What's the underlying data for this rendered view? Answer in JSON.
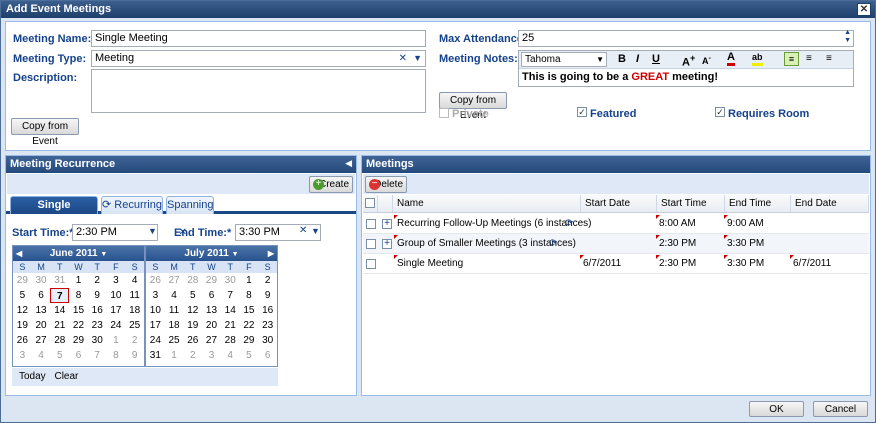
{
  "window": {
    "title": "Add Event Meetings"
  },
  "form": {
    "meeting_name_label": "Meeting Name:",
    "meeting_name_value": "Single Meeting",
    "meeting_type_label": "Meeting Type:",
    "meeting_type_value": "Meeting",
    "description_label": "Description:",
    "copy_from_event_left": "Copy from Event",
    "max_attendance_label": "Max Attendance:",
    "max_attendance_value": "25",
    "meeting_notes_label": "Meeting Notes:",
    "font_select": "Tahoma",
    "notes_text_before": "This is going to be a ",
    "notes_text_highlight": "GREAT",
    "notes_text_after": " meeting!",
    "copy_from_event_right": "Copy from Event",
    "private_label": "Private",
    "featured_label": "Featured",
    "requires_room_label": "Requires Room"
  },
  "recurrence": {
    "title": "Meeting Recurrence",
    "create_label": "Create",
    "tabs": [
      "Single Meeting(s)",
      "Recurring",
      "Spanning"
    ],
    "start_time_label": "Start Time:*",
    "start_time_value": "2:30 PM",
    "end_time_label": "End Time:*",
    "end_time_value": "3:30 PM",
    "today_label": "Today",
    "clear_label": "Clear",
    "day_headers": [
      "S",
      "M",
      "T",
      "W",
      "T",
      "F",
      "S"
    ],
    "june": {
      "title": "June 2011",
      "weeks": [
        [
          "29",
          "30",
          "31",
          "1",
          "2",
          "3",
          "4"
        ],
        [
          "5",
          "6",
          "7",
          "8",
          "9",
          "10",
          "11"
        ],
        [
          "12",
          "13",
          "14",
          "15",
          "16",
          "17",
          "18"
        ],
        [
          "19",
          "20",
          "21",
          "22",
          "23",
          "24",
          "25"
        ],
        [
          "26",
          "27",
          "28",
          "29",
          "30",
          "1",
          "2"
        ],
        [
          "3",
          "4",
          "5",
          "6",
          "7",
          "8",
          "9"
        ]
      ]
    },
    "july": {
      "title": "July 2011",
      "weeks": [
        [
          "26",
          "27",
          "28",
          "29",
          "30",
          "1",
          "2"
        ],
        [
          "3",
          "4",
          "5",
          "6",
          "7",
          "8",
          "9"
        ],
        [
          "10",
          "11",
          "12",
          "13",
          "14",
          "15",
          "16"
        ],
        [
          "17",
          "18",
          "19",
          "20",
          "21",
          "22",
          "23"
        ],
        [
          "24",
          "25",
          "26",
          "27",
          "28",
          "29",
          "30"
        ],
        [
          "31",
          "1",
          "2",
          "3",
          "4",
          "5",
          "6"
        ]
      ]
    }
  },
  "meetings": {
    "title": "Meetings",
    "delete_label": "Delete",
    "columns": [
      "Name",
      "Start Date",
      "Start Time",
      "End Time",
      "End Date"
    ],
    "rows": [
      {
        "name": "Recurring Follow-Up Meetings (6 instances)",
        "start_date": "",
        "start_time": "8:00 AM",
        "end_time": "9:00 AM",
        "end_date": ""
      },
      {
        "name": "Group of Smaller Meetings (3 instances)",
        "start_date": "",
        "start_time": "2:30 PM",
        "end_time": "3:30 PM",
        "end_date": ""
      },
      {
        "name": "Single Meeting",
        "start_date": "6/7/2011",
        "start_time": "2:30 PM",
        "end_time": "3:30 PM",
        "end_date": "6/7/2011"
      }
    ]
  },
  "footer": {
    "ok_label": "OK",
    "cancel_label": "Cancel"
  }
}
